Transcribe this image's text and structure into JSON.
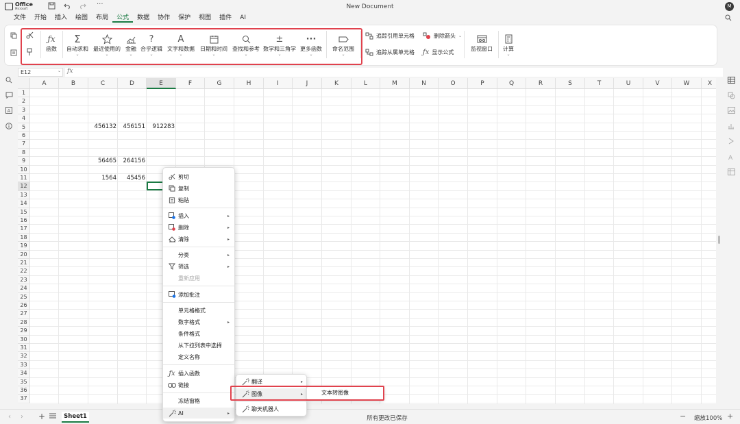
{
  "app": {
    "logo": "Office",
    "logo_sub": "Microsoft",
    "title": "New Document",
    "avatar": "M"
  },
  "menu_tabs": [
    "文件",
    "开始",
    "插入",
    "绘图",
    "布局",
    "公式",
    "数据",
    "协作",
    "保护",
    "视图",
    "插件",
    "AI"
  ],
  "active_tab": "公式",
  "ribbon": {
    "fx": "函数",
    "autosum": "自动求和",
    "recent": "最近使用的",
    "finance": "金融",
    "logic": "合乎逻辑",
    "text": "文字和数据",
    "datetime": "日期和时间",
    "lookup": "查找和参考",
    "math": "数学和三角学",
    "more": "更多函数",
    "namerange": "命名范围",
    "trace_prec": "追踪引用单元格",
    "trace_dep": "追踪从属单元格",
    "remove_arrows": "删除箭头",
    "show_formula": "显示公式",
    "watch": "监视窗口",
    "calc": "计算"
  },
  "formula_bar": {
    "namebox": "E12",
    "fx": "fx"
  },
  "columns": [
    "A",
    "B",
    "C",
    "D",
    "E",
    "F",
    "G",
    "H",
    "I",
    "J",
    "K",
    "L",
    "M",
    "N",
    "O",
    "P",
    "Q",
    "R",
    "S",
    "T",
    "U",
    "V",
    "W",
    "X"
  ],
  "selected_column": "E",
  "selected_row": "12",
  "rows": [
    "1",
    "2",
    "3",
    "4",
    "5",
    "6",
    "7",
    "8",
    "9",
    "10",
    "11",
    "12",
    "13",
    "14",
    "15",
    "16",
    "17",
    "18",
    "19",
    "20",
    "21",
    "22",
    "23",
    "24",
    "25",
    "26",
    "27",
    "28",
    "29",
    "30",
    "31",
    "32",
    "33",
    "34",
    "35",
    "36",
    "37"
  ],
  "cells": {
    "c5": "456132",
    "d5": "456151",
    "e5": "912283",
    "c9": "56465",
    "d9": "264156",
    "c11": "1564",
    "d11": "45456"
  },
  "context_menu": {
    "cut": "剪切",
    "copy": "复制",
    "paste": "粘贴",
    "insert": "插入",
    "delete": "删除",
    "clear": "清除",
    "sort": "分类",
    "filter": "筛选",
    "reapply": "重新应用",
    "add_comment": "添加批注",
    "cell_format": "单元格格式",
    "number_format": "数字格式",
    "cond_format": "条件格式",
    "pick_list": "从下拉列表中选择",
    "define_name": "定义名称",
    "insert_func": "插入函数",
    "link": "链接",
    "freeze": "冻结窗格",
    "ai": "AI"
  },
  "ai_submenu": {
    "translate": "翻译",
    "image": "图像",
    "chatbot": "聊天机器人"
  },
  "image_submenu": {
    "text_to_image": "文本转图像"
  },
  "status": {
    "sheet": "Sheet1",
    "save": "所有更改已保存",
    "zoom": "缩放100%"
  },
  "colors": {
    "accent": "#1a7a43",
    "highlight": "#e0424d"
  }
}
